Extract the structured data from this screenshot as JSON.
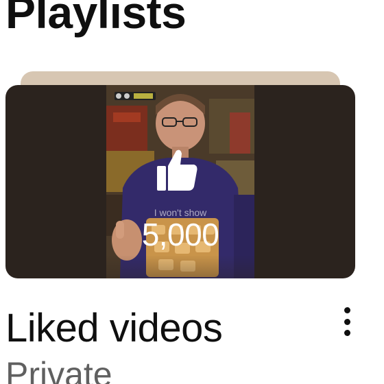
{
  "section": {
    "title": "Playlists"
  },
  "playlist": {
    "title": "Liked videos",
    "privacy": "Private",
    "thumbnail": {
      "caption": "I won't show",
      "count": "5,000",
      "icon": "thumbs-up-icon"
    },
    "more_icon": "more-vert-icon"
  },
  "colors": {
    "title_text": "#0f0f0f",
    "secondary_text": "#606060",
    "thumb_background": "#2b231e",
    "stack_tab": "#d7c6b2"
  }
}
